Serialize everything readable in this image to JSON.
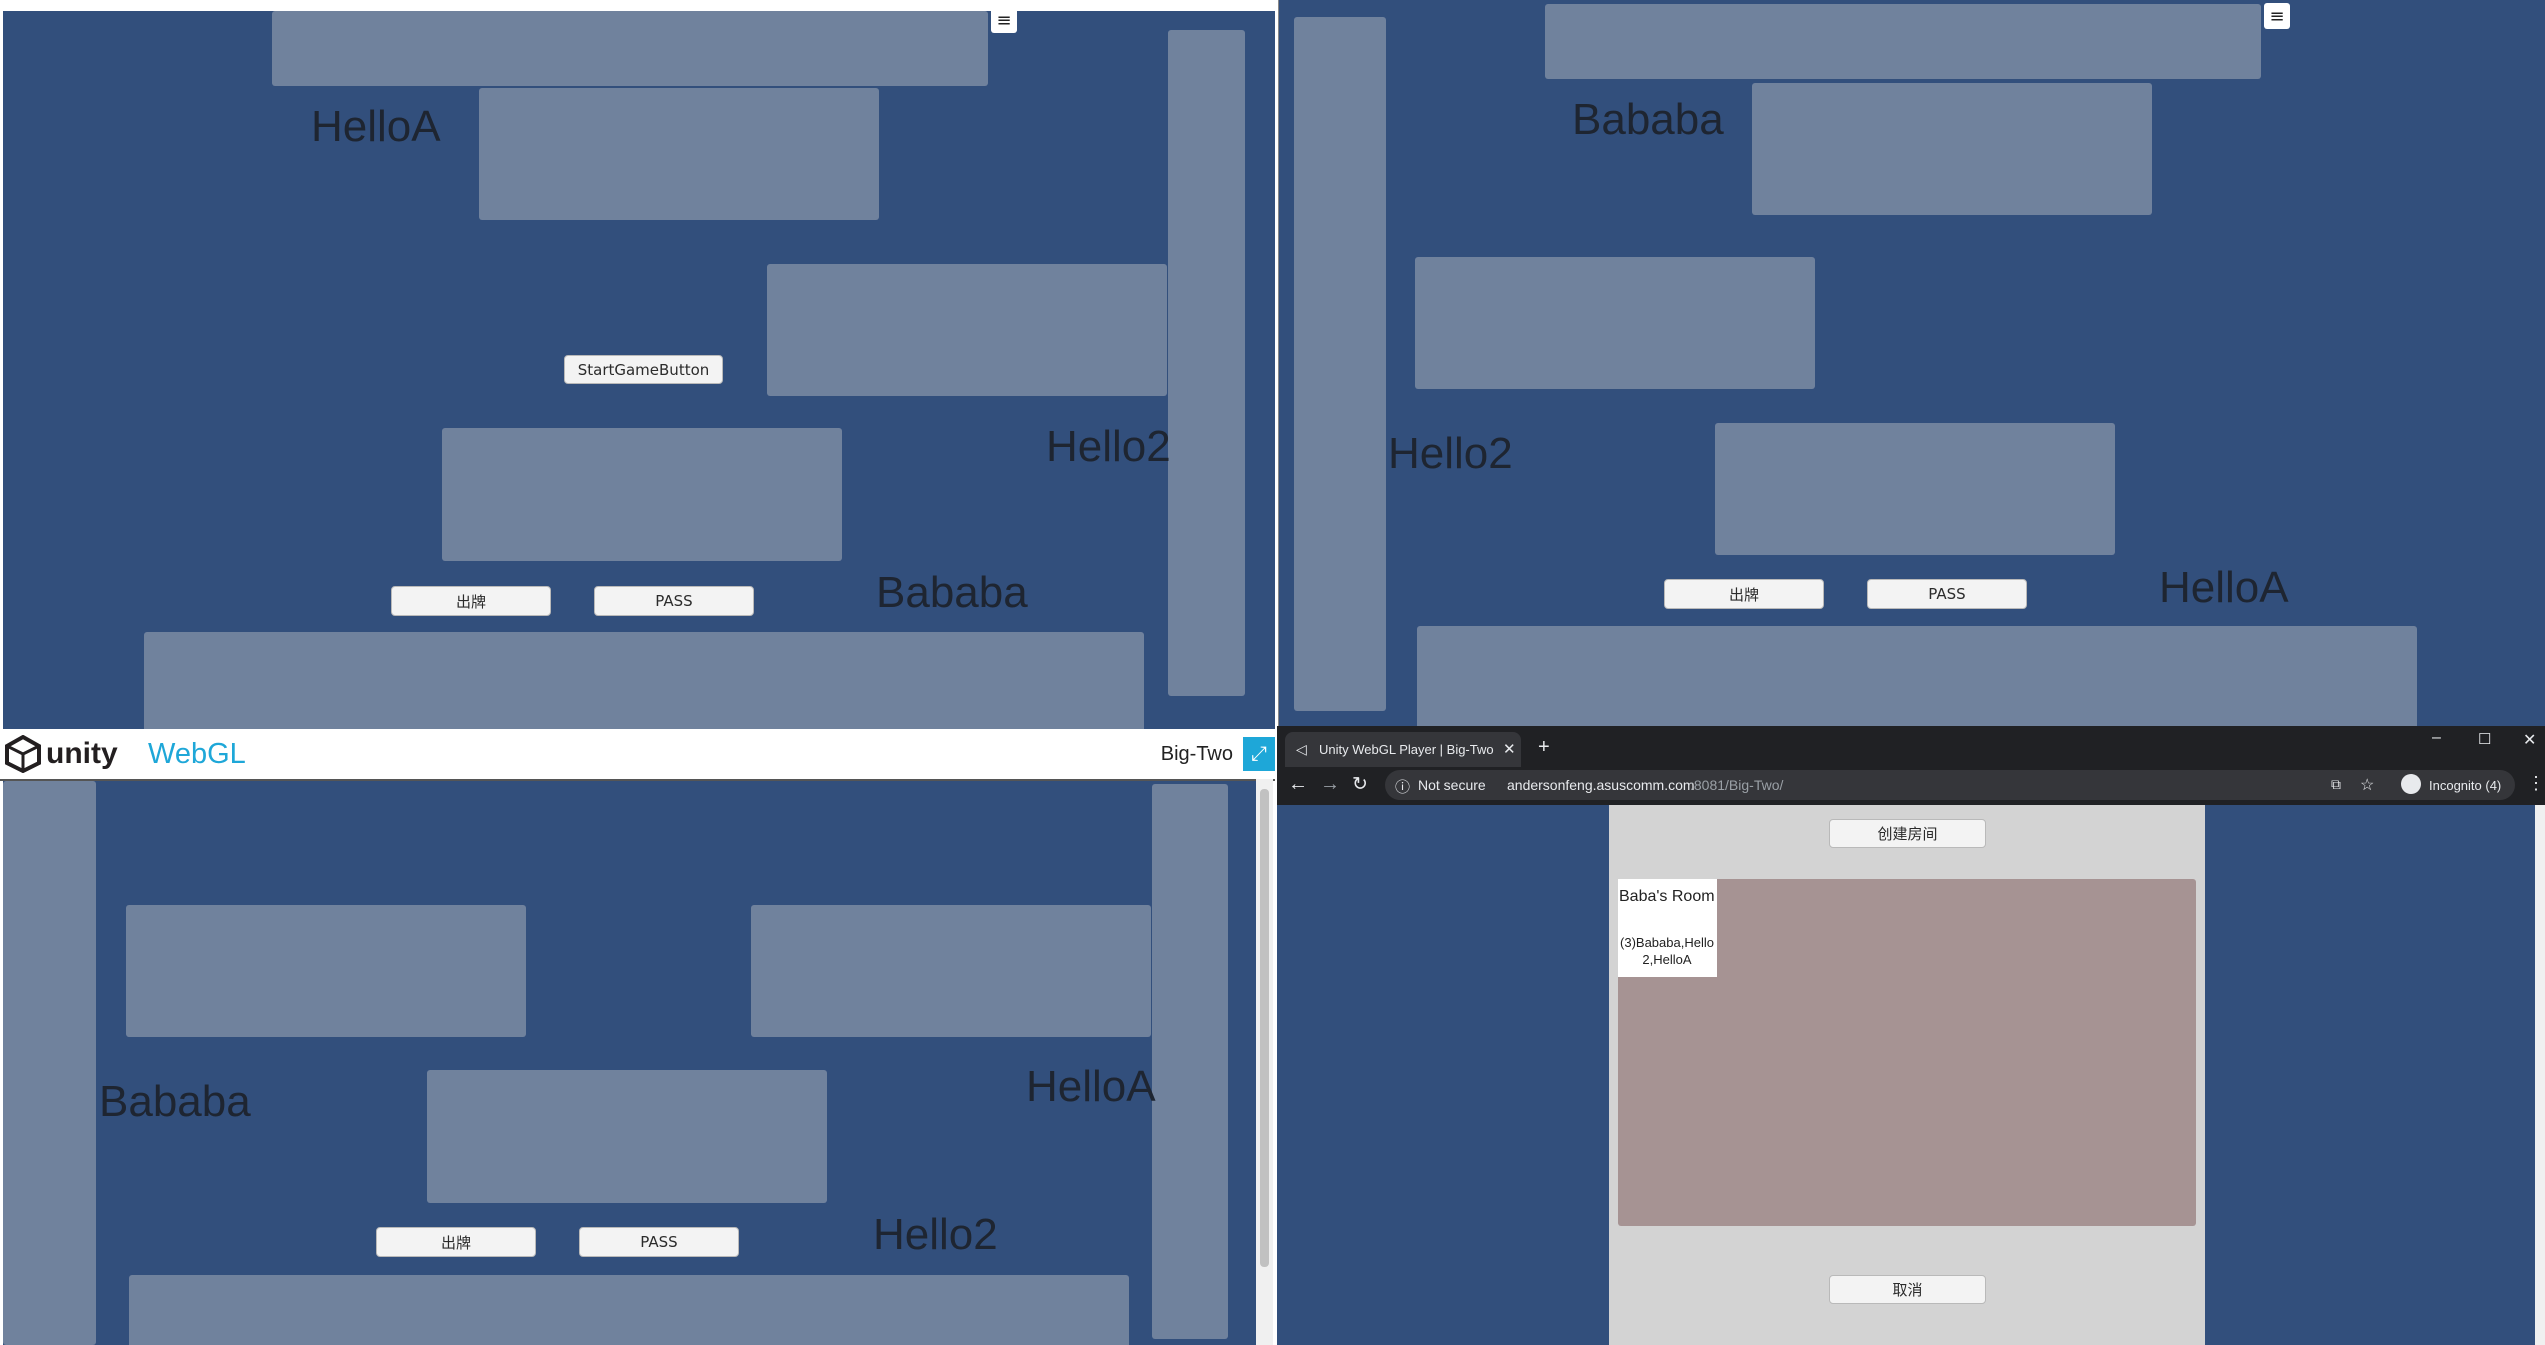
{
  "colors": {
    "game_bg": "#324f7c",
    "slot": "#70829d",
    "unity_blue": "#1ea7d8",
    "room_list_bg": "#a69393"
  },
  "panel_tl": {
    "players": {
      "top": "HelloA",
      "right": "Hello2",
      "bottom": "Bababa"
    },
    "start_button": "StartGameButton",
    "play_button": "出牌",
    "pass_button": "PASS",
    "menu_icon": "≡"
  },
  "panel_tr": {
    "players": {
      "top": "Bababa",
      "left": "Hello2",
      "bottom": "HelloA"
    },
    "play_button": "出牌",
    "pass_button": "PASS",
    "menu_icon": "≡"
  },
  "panel_bl": {
    "players": {
      "left": "Bababa",
      "right": "HelloA",
      "bottom": "Hello2"
    },
    "play_button": "出牌",
    "pass_button": "PASS"
  },
  "unity_footer": {
    "logo": "unity",
    "product": "WebGL",
    "game_title": "Big-Two"
  },
  "browser": {
    "tab_title": "Unity WebGL Player | Big-Two",
    "security": "Not secure",
    "url_host": "andersonfeng.asuscomm.com",
    "url_path": ":8081/Big-Two/",
    "profile": "Incognito (4)"
  },
  "lobby": {
    "create_room_button": "创建房间",
    "cancel_button": "取消",
    "room_name": "Baba's Room",
    "room_players": "(3)Bababa,Hello2,HelloA"
  }
}
